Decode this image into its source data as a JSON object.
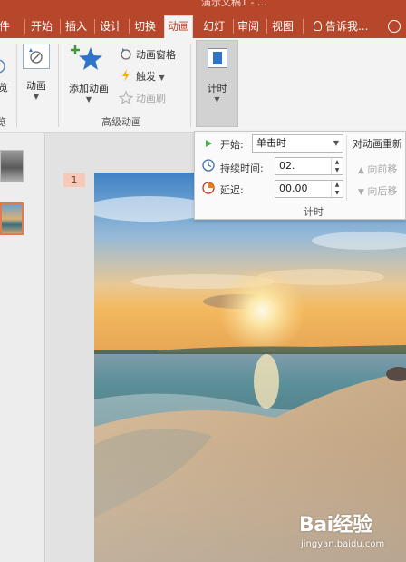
{
  "window": {
    "title": "演示文稿1 - ..."
  },
  "tabs": [
    {
      "label": "件"
    },
    {
      "label": "开始"
    },
    {
      "label": "插入"
    },
    {
      "label": "设计"
    },
    {
      "label": "切换"
    },
    {
      "label": "动画",
      "active": true
    },
    {
      "label": "幻灯"
    },
    {
      "label": "审阅"
    },
    {
      "label": "视图"
    }
  ],
  "tell_me": "告诉我...",
  "ribbon": {
    "preview_label": "览",
    "animation_btn": "动画",
    "add_animation": "添加动画",
    "animation_pane": "动画窗格",
    "trigger": "触发",
    "animation_painter": "动画刷",
    "advanced_group": "高级动画",
    "left_group_fragment": "览",
    "timing_btn": "计时"
  },
  "slides": {
    "current_number": "1"
  },
  "timing_popup": {
    "start_label": "开始:",
    "start_value": "单击时",
    "duration_label": "持续时间:",
    "duration_value": "02.",
    "delay_label": "延迟:",
    "delay_value": "00.00",
    "group_label": "计时",
    "reorder_title": "对动画重新",
    "move_earlier": "向前移",
    "move_later": "向后移"
  },
  "watermark": {
    "logo": "Bai经验",
    "url": "jingyan.baidu.com"
  },
  "colors": {
    "accent": "#b7472a",
    "ribbon_bg": "#f3f3f3",
    "selected_thumb": "#e07a50"
  }
}
